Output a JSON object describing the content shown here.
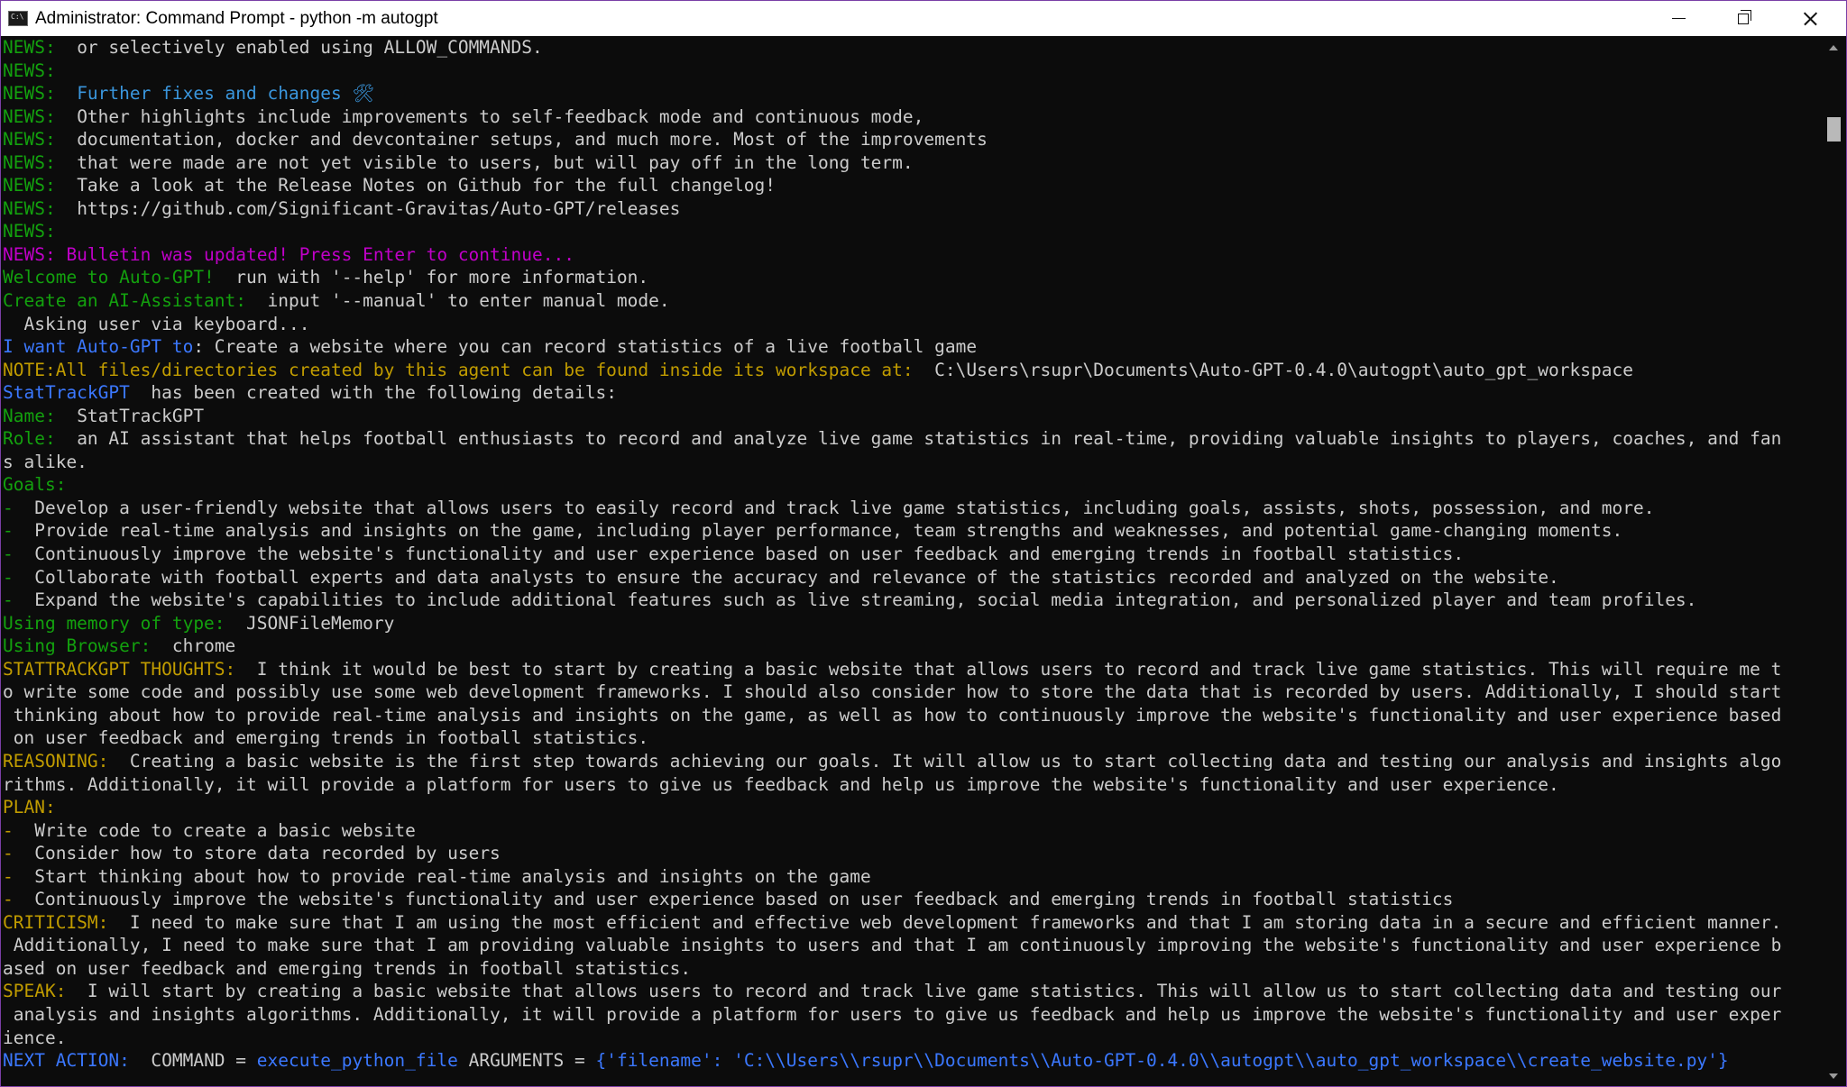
{
  "window": {
    "title": "Administrator: Command Prompt - python  -m autogpt",
    "icons": {
      "app": "cmd-icon",
      "minimize": "minimize-icon",
      "maximize": "restore-icon",
      "close": "close-icon"
    },
    "colors": {
      "green": "#13a10e",
      "blue": "#3b78ff",
      "yellow": "#c19c00",
      "magenta": "#c000c8",
      "cyan": "#3a96dd",
      "text": "#cccccc",
      "background": "#0c0c0c"
    }
  },
  "console": {
    "lines": [
      [
        {
          "t": "NEWS:  ",
          "c": "g"
        },
        {
          "t": "or selectively enabled using ALLOW_COMMANDS.",
          "c": "w"
        }
      ],
      [
        {
          "t": "NEWS:",
          "c": "g"
        }
      ],
      [
        {
          "t": "NEWS:  ",
          "c": "g"
        },
        {
          "t": "Further fixes and changes 🛠",
          "c": "c"
        }
      ],
      [
        {
          "t": "NEWS:  ",
          "c": "g"
        },
        {
          "t": "Other highlights include improvements to self-feedback mode and continuous mode,",
          "c": "w"
        }
      ],
      [
        {
          "t": "NEWS:  ",
          "c": "g"
        },
        {
          "t": "documentation, docker and devcontainer setups, and much more. Most of the improvements",
          "c": "w"
        }
      ],
      [
        {
          "t": "NEWS:  ",
          "c": "g"
        },
        {
          "t": "that were made are not yet visible to users, but will pay off in the long term.",
          "c": "w"
        }
      ],
      [
        {
          "t": "NEWS:  ",
          "c": "g"
        },
        {
          "t": "Take a look at the Release Notes on Github for the full changelog!",
          "c": "w"
        }
      ],
      [
        {
          "t": "NEWS:  ",
          "c": "g"
        },
        {
          "t": "https://github.com/Significant-Gravitas/Auto-GPT/releases",
          "c": "w"
        }
      ],
      [
        {
          "t": "NEWS:",
          "c": "g"
        }
      ],
      [
        {
          "t": "NEWS: Bulletin was updated! Press Enter to continue...",
          "c": "m"
        }
      ],
      [
        {
          "t": "Welcome to Auto-GPT!",
          "c": "g"
        },
        {
          "t": "  run with '--help' for more information.",
          "c": "w"
        }
      ],
      [
        {
          "t": "Create an AI-Assistant:",
          "c": "g"
        },
        {
          "t": "  input '--manual' to enter manual mode.",
          "c": "w"
        }
      ],
      [
        {
          "t": "  Asking user via keyboard...",
          "c": "w"
        }
      ],
      [
        {
          "t": "I want Auto-GPT to",
          "c": "b"
        },
        {
          "t": ": Create a website where you can record statistics of a live football game",
          "c": "w"
        }
      ],
      [
        {
          "t": "NOTE:All files/directories created by this agent can be found inside its workspace at:",
          "c": "y"
        },
        {
          "t": "  C:\\Users\\rsupr\\Documents\\Auto-GPT-0.4.0\\autogpt\\auto_gpt_workspace",
          "c": "w"
        }
      ],
      [
        {
          "t": "StatTrackGPT",
          "c": "b"
        },
        {
          "t": "  has been created with the following details:",
          "c": "w"
        }
      ],
      [
        {
          "t": "Name:  ",
          "c": "g"
        },
        {
          "t": "StatTrackGPT",
          "c": "w"
        }
      ],
      [
        {
          "t": "Role:  ",
          "c": "g"
        },
        {
          "t": "an AI assistant that helps football enthusiasts to record and analyze live game statistics in real-time, providing valuable insights to players, coaches, and fan",
          "c": "w"
        }
      ],
      [
        {
          "t": "s alike.",
          "c": "w"
        }
      ],
      [
        {
          "t": "Goals:",
          "c": "g"
        }
      ],
      [
        {
          "t": "-  ",
          "c": "g"
        },
        {
          "t": "Develop a user-friendly website that allows users to easily record and track live game statistics, including goals, assists, shots, possession, and more.",
          "c": "w"
        }
      ],
      [
        {
          "t": "-  ",
          "c": "g"
        },
        {
          "t": "Provide real-time analysis and insights on the game, including player performance, team strengths and weaknesses, and potential game-changing moments.",
          "c": "w"
        }
      ],
      [
        {
          "t": "-  ",
          "c": "g"
        },
        {
          "t": "Continuously improve the website's functionality and user experience based on user feedback and emerging trends in football statistics.",
          "c": "w"
        }
      ],
      [
        {
          "t": "-  ",
          "c": "g"
        },
        {
          "t": "Collaborate with football experts and data analysts to ensure the accuracy and relevance of the statistics recorded and analyzed on the website.",
          "c": "w"
        }
      ],
      [
        {
          "t": "-  ",
          "c": "g"
        },
        {
          "t": "Expand the website's capabilities to include additional features such as live streaming, social media integration, and personalized player and team profiles.",
          "c": "w"
        }
      ],
      [
        {
          "t": "Using memory of type:",
          "c": "g"
        },
        {
          "t": "  JSONFileMemory",
          "c": "w"
        }
      ],
      [
        {
          "t": "Using Browser:",
          "c": "g"
        },
        {
          "t": "  chrome",
          "c": "w"
        }
      ],
      [
        {
          "t": "STATTRACKGPT THOUGHTS:",
          "c": "y"
        },
        {
          "t": "  I think it would be best to start by creating a basic website that allows users to record and track live game statistics. This will require me t",
          "c": "w"
        }
      ],
      [
        {
          "t": "o write some code and possibly use some web development frameworks. I should also consider how to store the data that is recorded by users. Additionally, I should start",
          "c": "w"
        }
      ],
      [
        {
          "t": " thinking about how to provide real-time analysis and insights on the game, as well as how to continuously improve the website's functionality and user experience based",
          "c": "w"
        }
      ],
      [
        {
          "t": " on user feedback and emerging trends in football statistics.",
          "c": "w"
        }
      ],
      [
        {
          "t": "REASONING:",
          "c": "y"
        },
        {
          "t": "  Creating a basic website is the first step towards achieving our goals. It will allow us to start collecting data and testing our analysis and insights algo",
          "c": "w"
        }
      ],
      [
        {
          "t": "rithms. Additionally, it will provide a platform for users to give us feedback and help us improve the website's functionality and user experience.",
          "c": "w"
        }
      ],
      [
        {
          "t": "PLAN:",
          "c": "y"
        }
      ],
      [
        {
          "t": "-  ",
          "c": "y"
        },
        {
          "t": "Write code to create a basic website",
          "c": "w"
        }
      ],
      [
        {
          "t": "-  ",
          "c": "y"
        },
        {
          "t": "Consider how to store data recorded by users",
          "c": "w"
        }
      ],
      [
        {
          "t": "-  ",
          "c": "y"
        },
        {
          "t": "Start thinking about how to provide real-time analysis and insights on the game",
          "c": "w"
        }
      ],
      [
        {
          "t": "-  ",
          "c": "y"
        },
        {
          "t": "Continuously improve the website's functionality and user experience based on user feedback and emerging trends in football statistics",
          "c": "w"
        }
      ],
      [
        {
          "t": "CRITICISM:",
          "c": "y"
        },
        {
          "t": "  I need to make sure that I am using the most efficient and effective web development frameworks and that I am storing data in a secure and efficient manner.",
          "c": "w"
        }
      ],
      [
        {
          "t": " Additionally, I need to make sure that I am providing valuable insights to users and that I am continuously improving the website's functionality and user experience b",
          "c": "w"
        }
      ],
      [
        {
          "t": "ased on user feedback and emerging trends in football statistics.",
          "c": "w"
        }
      ],
      [
        {
          "t": "SPEAK:",
          "c": "y"
        },
        {
          "t": "  I will start by creating a basic website that allows users to record and track live game statistics. This will allow us to start collecting data and testing our",
          "c": "w"
        }
      ],
      [
        {
          "t": " analysis and insights algorithms. Additionally, it will provide a platform for users to give us feedback and help us improve the website's functionality and user exper",
          "c": "w"
        }
      ],
      [
        {
          "t": "ience.",
          "c": "w"
        }
      ],
      [
        {
          "t": "NEXT ACTION:",
          "c": "b"
        },
        {
          "t": "  COMMAND = ",
          "c": "w"
        },
        {
          "t": "execute_python_file",
          "c": "b"
        },
        {
          "t": " ARGUMENTS = ",
          "c": "w"
        },
        {
          "t": "{'filename': 'C:\\\\Users\\\\rsupr\\\\Documents\\\\Auto-GPT-0.4.0\\\\autogpt\\\\auto_gpt_workspace\\\\create_website.py'}",
          "c": "b"
        }
      ]
    ]
  }
}
